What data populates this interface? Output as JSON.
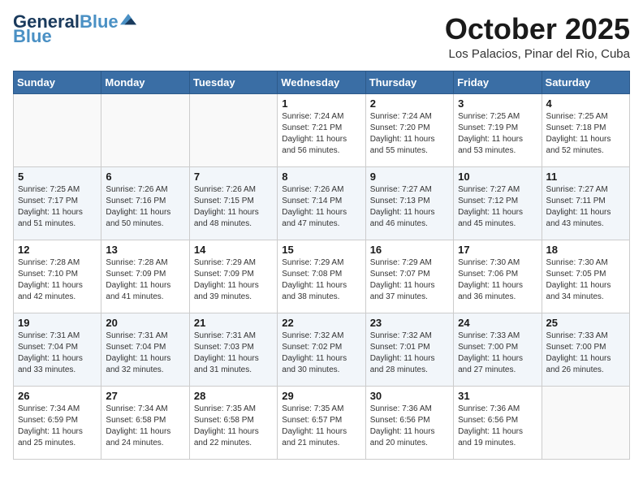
{
  "header": {
    "logo_general": "General",
    "logo_blue": "Blue",
    "month_title": "October 2025",
    "location": "Los Palacios, Pinar del Rio, Cuba"
  },
  "days_of_week": [
    "Sunday",
    "Monday",
    "Tuesday",
    "Wednesday",
    "Thursday",
    "Friday",
    "Saturday"
  ],
  "weeks": [
    [
      {
        "day": "",
        "info": ""
      },
      {
        "day": "",
        "info": ""
      },
      {
        "day": "",
        "info": ""
      },
      {
        "day": "1",
        "info": "Sunrise: 7:24 AM\nSunset: 7:21 PM\nDaylight: 11 hours and 56 minutes."
      },
      {
        "day": "2",
        "info": "Sunrise: 7:24 AM\nSunset: 7:20 PM\nDaylight: 11 hours and 55 minutes."
      },
      {
        "day": "3",
        "info": "Sunrise: 7:25 AM\nSunset: 7:19 PM\nDaylight: 11 hours and 53 minutes."
      },
      {
        "day": "4",
        "info": "Sunrise: 7:25 AM\nSunset: 7:18 PM\nDaylight: 11 hours and 52 minutes."
      }
    ],
    [
      {
        "day": "5",
        "info": "Sunrise: 7:25 AM\nSunset: 7:17 PM\nDaylight: 11 hours and 51 minutes."
      },
      {
        "day": "6",
        "info": "Sunrise: 7:26 AM\nSunset: 7:16 PM\nDaylight: 11 hours and 50 minutes."
      },
      {
        "day": "7",
        "info": "Sunrise: 7:26 AM\nSunset: 7:15 PM\nDaylight: 11 hours and 48 minutes."
      },
      {
        "day": "8",
        "info": "Sunrise: 7:26 AM\nSunset: 7:14 PM\nDaylight: 11 hours and 47 minutes."
      },
      {
        "day": "9",
        "info": "Sunrise: 7:27 AM\nSunset: 7:13 PM\nDaylight: 11 hours and 46 minutes."
      },
      {
        "day": "10",
        "info": "Sunrise: 7:27 AM\nSunset: 7:12 PM\nDaylight: 11 hours and 45 minutes."
      },
      {
        "day": "11",
        "info": "Sunrise: 7:27 AM\nSunset: 7:11 PM\nDaylight: 11 hours and 43 minutes."
      }
    ],
    [
      {
        "day": "12",
        "info": "Sunrise: 7:28 AM\nSunset: 7:10 PM\nDaylight: 11 hours and 42 minutes."
      },
      {
        "day": "13",
        "info": "Sunrise: 7:28 AM\nSunset: 7:09 PM\nDaylight: 11 hours and 41 minutes."
      },
      {
        "day": "14",
        "info": "Sunrise: 7:29 AM\nSunset: 7:09 PM\nDaylight: 11 hours and 39 minutes."
      },
      {
        "day": "15",
        "info": "Sunrise: 7:29 AM\nSunset: 7:08 PM\nDaylight: 11 hours and 38 minutes."
      },
      {
        "day": "16",
        "info": "Sunrise: 7:29 AM\nSunset: 7:07 PM\nDaylight: 11 hours and 37 minutes."
      },
      {
        "day": "17",
        "info": "Sunrise: 7:30 AM\nSunset: 7:06 PM\nDaylight: 11 hours and 36 minutes."
      },
      {
        "day": "18",
        "info": "Sunrise: 7:30 AM\nSunset: 7:05 PM\nDaylight: 11 hours and 34 minutes."
      }
    ],
    [
      {
        "day": "19",
        "info": "Sunrise: 7:31 AM\nSunset: 7:04 PM\nDaylight: 11 hours and 33 minutes."
      },
      {
        "day": "20",
        "info": "Sunrise: 7:31 AM\nSunset: 7:04 PM\nDaylight: 11 hours and 32 minutes."
      },
      {
        "day": "21",
        "info": "Sunrise: 7:31 AM\nSunset: 7:03 PM\nDaylight: 11 hours and 31 minutes."
      },
      {
        "day": "22",
        "info": "Sunrise: 7:32 AM\nSunset: 7:02 PM\nDaylight: 11 hours and 30 minutes."
      },
      {
        "day": "23",
        "info": "Sunrise: 7:32 AM\nSunset: 7:01 PM\nDaylight: 11 hours and 28 minutes."
      },
      {
        "day": "24",
        "info": "Sunrise: 7:33 AM\nSunset: 7:00 PM\nDaylight: 11 hours and 27 minutes."
      },
      {
        "day": "25",
        "info": "Sunrise: 7:33 AM\nSunset: 7:00 PM\nDaylight: 11 hours and 26 minutes."
      }
    ],
    [
      {
        "day": "26",
        "info": "Sunrise: 7:34 AM\nSunset: 6:59 PM\nDaylight: 11 hours and 25 minutes."
      },
      {
        "day": "27",
        "info": "Sunrise: 7:34 AM\nSunset: 6:58 PM\nDaylight: 11 hours and 24 minutes."
      },
      {
        "day": "28",
        "info": "Sunrise: 7:35 AM\nSunset: 6:58 PM\nDaylight: 11 hours and 22 minutes."
      },
      {
        "day": "29",
        "info": "Sunrise: 7:35 AM\nSunset: 6:57 PM\nDaylight: 11 hours and 21 minutes."
      },
      {
        "day": "30",
        "info": "Sunrise: 7:36 AM\nSunset: 6:56 PM\nDaylight: 11 hours and 20 minutes."
      },
      {
        "day": "31",
        "info": "Sunrise: 7:36 AM\nSunset: 6:56 PM\nDaylight: 11 hours and 19 minutes."
      },
      {
        "day": "",
        "info": ""
      }
    ]
  ]
}
